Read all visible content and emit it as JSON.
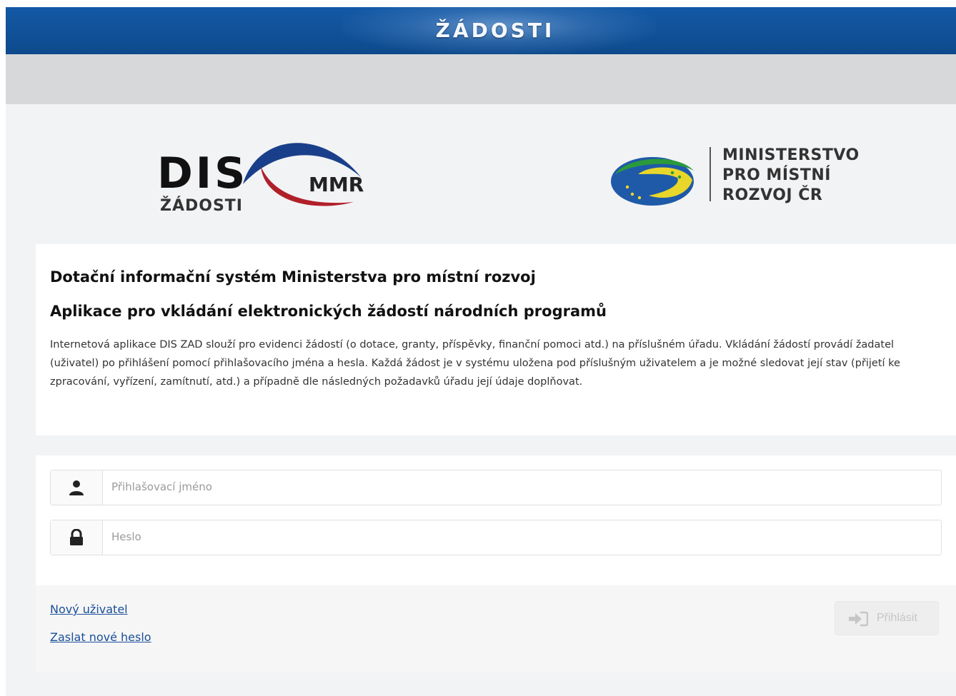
{
  "header": {
    "title": "ŽÁDOSTI"
  },
  "logos": {
    "dis": {
      "main": "DIS",
      "mmr": "MMR",
      "sub": "ŽÁDOSTI"
    },
    "ministry": {
      "lines": [
        "MINISTERSTVO",
        "PRO MÍSTNÍ",
        "ROZVOJ ČR"
      ]
    }
  },
  "info": {
    "heading1": "Dotační informační systém Ministerstva pro místní rozvoj",
    "heading2": "Aplikace pro vkládání elektronických žádostí národních programů",
    "description": "Internetová aplikace DIS ZAD slouží pro evidenci žádostí (o dotace, granty, příspěvky, finanční pomoci atd.) na příslušném úřadu. Vkládání žádostí provádí žadatel (uživatel) po přihlášení pomocí přihlašovacího jména a hesla. Každá žádost je v systému uložena pod příslušným uživatelem a je možné sledovat její stav (přijetí ke zpracování, vyřízení, zamítnutí, atd.) a případně dle následných požadavků úřadu její údaje doplňovat."
  },
  "login": {
    "username_placeholder": "Přihlašovací jméno",
    "username_value": "",
    "password_placeholder": "Heslo",
    "password_value": "",
    "new_user_link": "Nový uživatel",
    "reset_password_link": "Zaslat nové heslo",
    "submit_label": "Přihlásit"
  },
  "icons": {
    "username": "user-icon",
    "password": "lock-icon",
    "submit": "sign-in-icon"
  },
  "colors": {
    "header_blue": "#0f4f94",
    "link_blue": "#1a4f99",
    "logo_red": "#b0202a",
    "logo_blue": "#1a3f8a"
  }
}
